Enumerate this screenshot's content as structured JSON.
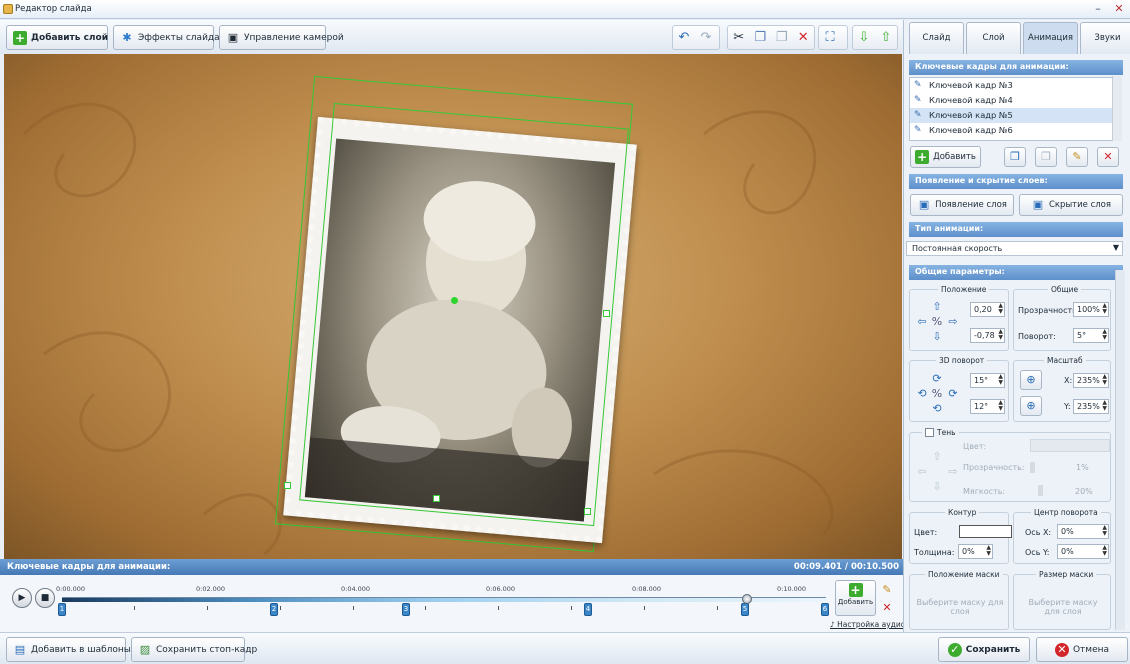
{
  "window": {
    "title": "Редактор слайда"
  },
  "toolbar": {
    "add_layer": "Добавить слой",
    "slide_effects": "Эффекты слайда",
    "camera": "Управление камерой"
  },
  "timeline": {
    "header": "Ключевые кадры для анимации:",
    "time": "00:09.401 / 00:10.500",
    "ticks": [
      "0:00.000",
      "0:02.000",
      "0:04.000",
      "0:06.000",
      "0:08.000",
      "0:10.000"
    ],
    "keyframes": [
      "1",
      "2",
      "3",
      "4",
      "5",
      "6"
    ],
    "add_label": "Добавить",
    "audio_label": "Настройка аудио"
  },
  "bottom": {
    "add_template": "Добавить в шаблоны",
    "save_frame": "Сохранить стоп-кадр",
    "save": "Сохранить",
    "cancel": "Отмена"
  },
  "panel": {
    "tabs": [
      "Слайд",
      "Слой",
      "Анимация",
      "Звуки"
    ],
    "kf_header": "Ключевые кадры для анимации:",
    "kf_items": [
      "Ключевой кадр №3",
      "Ключевой кадр №4",
      "Ключевой кадр №5",
      "Ключевой кадр №6"
    ],
    "kf_add": "Добавить",
    "appear_header": "Появление и скрытие слоев:",
    "appear_btn": "Появление слоя",
    "hide_btn": "Скрытие слоя",
    "type_header": "Тип анимации:",
    "type_value": "Постоянная скорость",
    "params_header": "Общие параметры:",
    "position_label": "Положение",
    "pos_x": "0,20",
    "pos_y": "-0,78",
    "common_label": "Общие",
    "opacity_label": "Прозрачность:",
    "opacity_value": "100%",
    "rotation_label": "Поворот:",
    "rotation_value": "5°",
    "rot3d_label": "3D поворот",
    "rot3d_x": "15°",
    "rot3d_y": "12°",
    "scale_label": "Масштаб",
    "scale_x_label": "X:",
    "scale_x": "235%",
    "scale_y_label": "Y:",
    "scale_y": "235%",
    "shadow_label": "Тень",
    "shadow_color": "Цвет:",
    "shadow_opacity": "Прозрачность:",
    "shadow_opacity_value": "1%",
    "shadow_soft": "Мягкость:",
    "shadow_soft_value": "20%",
    "contour_label": "Контур",
    "contour_color": "Цвет:",
    "contour_thickness": "Толщина:",
    "contour_thickness_value": "0%",
    "pivot_label": "Центр поворота",
    "pivot_x_label": "Ось X:",
    "pivot_x": "0%",
    "pivot_y_label": "Ось Y:",
    "pivot_y": "0%",
    "mask_pos_label": "Положение маски",
    "mask_size_label": "Размер маски",
    "mask_hint": "Выберите маску для слоя"
  }
}
